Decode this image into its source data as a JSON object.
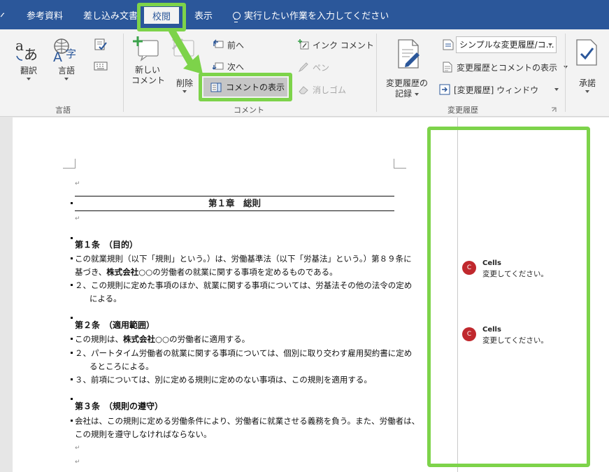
{
  "tabs": {
    "edge": "へ",
    "references": "参考資料",
    "mailings": "差し込み文書",
    "review": "校閲",
    "view": "表示",
    "tell_me": "実行したい作業を入力してください"
  },
  "ribbon": {
    "language_group": {
      "label": "言語",
      "translate": "翻訳",
      "language": "言語"
    },
    "comments_group": {
      "label": "コメント",
      "new_comment_line1": "新しい",
      "new_comment_line2": "コメント",
      "delete": "削除",
      "previous": "前へ",
      "next": "次へ",
      "show_comments": "コメントの表示",
      "ink_comment": "インク コメント",
      "pen": "ペン",
      "eraser": "消しゴム"
    },
    "tracking_group": {
      "label": "変更履歴",
      "track_changes_line1": "変更履歴の",
      "track_changes_line2": "記録",
      "markup_combo": "シンプルな変更履歴/コ…",
      "show_markup": "変更履歴とコメントの表示",
      "reviewing_pane": "[変更履歴] ウィンドウ"
    },
    "changes_group": {
      "accept": "承諾"
    }
  },
  "document": {
    "empty_mark": "↵",
    "chapter_title": "第１章　総則",
    "articles": [
      {
        "heading": "第１条　（目的）",
        "lines": [
          "この就業規則（以下「規則」という。）は、労働基準法（以下「労基法」という。）第８９条に",
          "基づき、",
          "株式会社○○",
          "の労働者の就業に関する事項を定めるものである。",
          "２、この規則に定めた事項のほか、就業に関する事項については、労基法その他の法令の定め",
          "による。"
        ]
      },
      {
        "heading": "第２条　（適用範囲）",
        "lines": [
          "この規則は、",
          "株式会社○○",
          "の労働者に適用する。",
          "２、パートタイム労働者の就業に関する事項については、個別に取り交わす雇用契約書に定め",
          "るところによる。",
          "３、前項については、別に定める規則に定めのない事項は、この規則を適用する。"
        ]
      },
      {
        "heading": "第３条　（規則の遵守）",
        "lines": [
          "会社は、この規則に定める労働条件により、労働者に就業させる義務を負う。また、労働者は、",
          "この規則を遵守しなければならない。"
        ]
      }
    ]
  },
  "comments": [
    {
      "initial": "C",
      "author": "Cells",
      "text": "変更してください。"
    },
    {
      "initial": "C",
      "author": "Cells",
      "text": "変更してください。"
    }
  ],
  "colors": {
    "title_bar": "#2b579a",
    "highlight": "#7dd34a",
    "avatar": "#c0282d"
  }
}
